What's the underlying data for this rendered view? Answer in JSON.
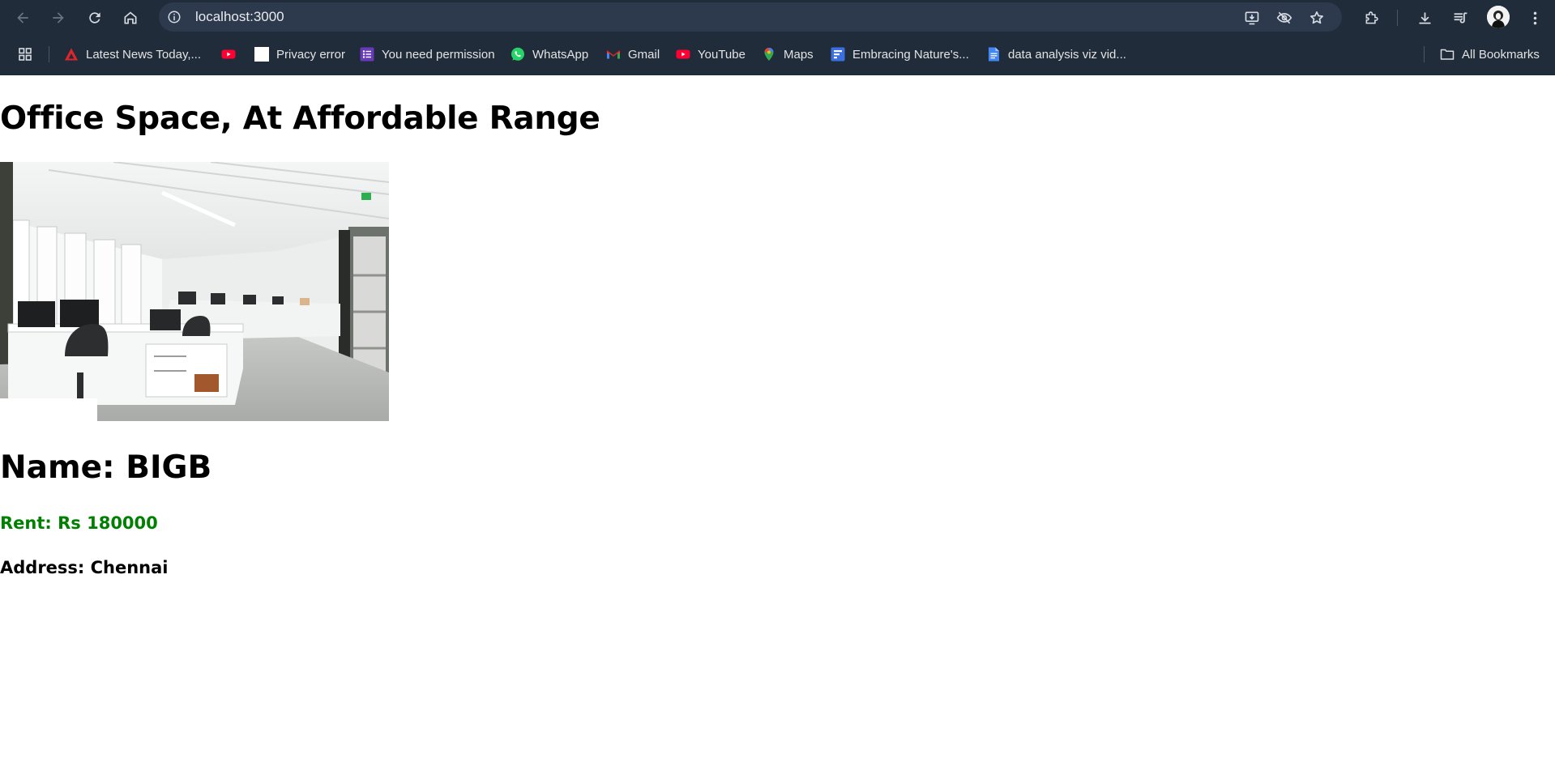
{
  "browser": {
    "url": "localhost:3000",
    "bookmarks": [
      {
        "label": "Latest News Today,...",
        "icon": "news-logo-icon"
      },
      {
        "label": "",
        "icon": "youtube-icon"
      },
      {
        "label": "Privacy error",
        "icon": "blank-page-icon"
      },
      {
        "label": "You need permission",
        "icon": "forms-icon"
      },
      {
        "label": "WhatsApp",
        "icon": "whatsapp-icon"
      },
      {
        "label": "Gmail",
        "icon": "gmail-icon"
      },
      {
        "label": "YouTube",
        "icon": "youtube-icon"
      },
      {
        "label": "Maps",
        "icon": "maps-icon"
      },
      {
        "label": "Embracing Nature's...",
        "icon": "forms-blue-icon"
      },
      {
        "label": "data analysis viz vid...",
        "icon": "docs-icon"
      }
    ],
    "all_bookmarks_label": "All Bookmarks",
    "colors": {
      "chrome_bg": "#212c3b",
      "omnibox_bg": "#2d3a4d"
    }
  },
  "page": {
    "title": "Office Space, At Affordable Range",
    "image_alt": "office interior photo",
    "name_label": "Name: BIGB",
    "rent_label": "Rent: Rs 180000",
    "address_label": "Address: Chennai",
    "colors": {
      "rent": "#008000",
      "text": "#000000"
    }
  }
}
